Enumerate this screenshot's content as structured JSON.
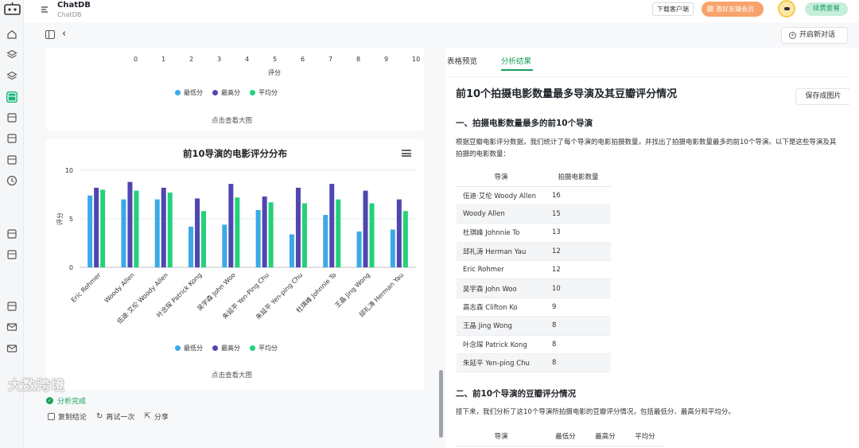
{
  "app": {
    "title": "ChatDB",
    "subtitle": "ChatDB"
  },
  "header": {
    "download_label": "下载客户端",
    "promo_label": "邀好友赚会员",
    "renew_label": "续费套餐"
  },
  "toolbar": {
    "new_chat_label": "开启新对话"
  },
  "rail_icons": [
    "home-icon",
    "layers-icon",
    "stack-icon",
    "database-icon",
    "table-icon",
    "layout-icon",
    "book-icon",
    "clock-icon",
    "db-icon",
    "db-list-icon",
    "notebook-icon",
    "mail-icon",
    "mail-alt-icon"
  ],
  "colors": {
    "min": "#3ba9e6",
    "max": "#4f46b0",
    "avg": "#23d17a",
    "accent": "#18a058"
  },
  "top_card": {
    "x_ticks": [
      "0",
      "1",
      "2",
      "3",
      "4",
      "5",
      "6",
      "7",
      "8",
      "9",
      "10"
    ],
    "x_label": "评分",
    "legend": [
      "最低分",
      "最高分",
      "平均分"
    ],
    "view_big": "点击查看大图"
  },
  "main_card": {
    "view_big": "点击查看大图"
  },
  "chart_data": {
    "type": "bar",
    "title": "前10导演的电影评分分布",
    "xlabel": "",
    "ylabel": "评分",
    "ylim": [
      0,
      10
    ],
    "y_ticks": [
      "0",
      "5",
      "10"
    ],
    "grid": true,
    "legend_position": "bottom",
    "categories": [
      "Eric Rohmer",
      "Woody Allen",
      "伍迪·艾伦 Woody Allen",
      "叶念琛 Patrick Kong",
      "吴宇森 John Woo",
      "朱延平 Yen-Ping Chu",
      "朱延平 Yen-ping Chu",
      "杜琪峰 Johnnie To",
      "王晶 Jing Wong",
      "邱礼涛 Herman Yau"
    ],
    "series": [
      {
        "name": "最低分",
        "values": [
          7.4,
          7.0,
          7.0,
          4.2,
          4.4,
          5.9,
          3.4,
          5.4,
          3.7,
          3.9
        ]
      },
      {
        "name": "最高分",
        "values": [
          8.2,
          8.8,
          8.2,
          7.1,
          8.6,
          7.3,
          8.2,
          8.6,
          7.9,
          7.0
        ]
      },
      {
        "name": "平均分",
        "values": [
          8.0,
          7.9,
          7.7,
          5.8,
          7.2,
          6.7,
          6.6,
          7.0,
          6.6,
          5.8
        ]
      }
    ]
  },
  "status": {
    "done_label": "分析完成"
  },
  "actions": {
    "copy_label": "复制结论",
    "retry_label": "再试一次",
    "share_label": "分享"
  },
  "watermark": "大数跨境",
  "right": {
    "tabs": [
      "表格预览",
      "分析结果"
    ],
    "title": "前10个拍摄电影数量最多导演及其豆瓣评分情况",
    "save_label": "保存成图片",
    "section1": {
      "heading": "一、拍摄电影数量最多的前10个导演",
      "paragraph": "根据豆瓣电影评分数据，我们统计了每个导演的电影拍摄数量，并找出了拍摄电影数量最多的前10个导演。以下是这些导演及其拍摄的电影数量：",
      "headers": [
        "导演",
        "拍摄电影数量"
      ],
      "rows": [
        [
          "伍迪·艾伦 Woody Allen",
          "16"
        ],
        [
          "Woody Allen",
          "15"
        ],
        [
          "杜琪峰 Johnnie To",
          "13"
        ],
        [
          "邱礼涛 Herman Yau",
          "12"
        ],
        [
          "Eric Rohmer",
          "12"
        ],
        [
          "吴宇森 John Woo",
          "10"
        ],
        [
          "高志森 Clifton Ko",
          "9"
        ],
        [
          "王晶 Jing Wong",
          "8"
        ],
        [
          "叶念琛 Patrick Kong",
          "8"
        ],
        [
          "朱延平 Yen-ping Chu",
          "8"
        ]
      ]
    },
    "section2": {
      "heading": "二、前10个导演的豆瓣评分情况",
      "paragraph": "接下来，我们分析了这10个导演所拍摄电影的豆瓣评分情况，包括最低分、最高分和平均分。",
      "headers": [
        "导演",
        "最低分",
        "最高分",
        "平均分"
      ]
    }
  }
}
